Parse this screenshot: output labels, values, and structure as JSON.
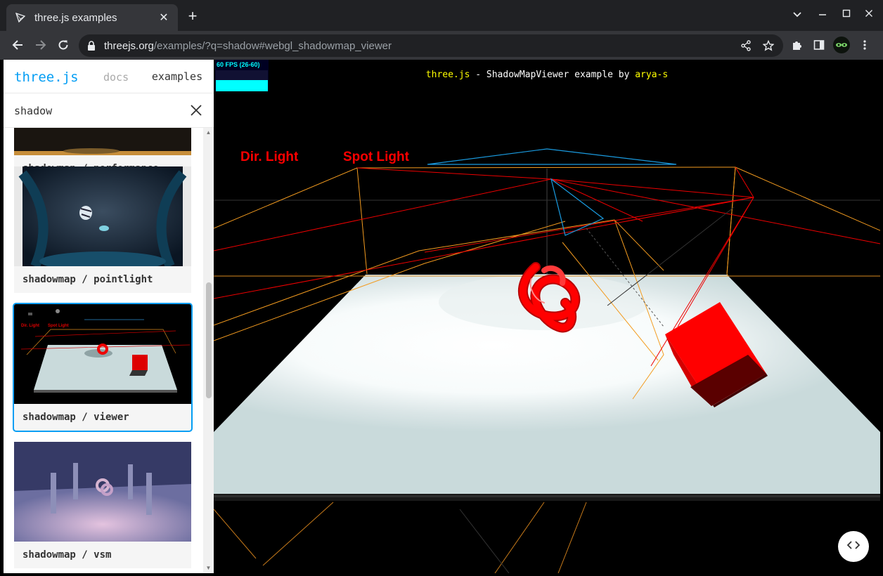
{
  "browser": {
    "tab_title": "three.js examples",
    "url_host": "threejs.org",
    "url_path": "/examples/?q=shadow#webgl_shadowmap_viewer"
  },
  "sidebar": {
    "brand": "three.js",
    "nav_docs": "docs",
    "nav_examples": "examples",
    "search_value": "shadow",
    "examples": [
      {
        "label": "shadowmap / performance"
      },
      {
        "label": "shadowmap / pointlight"
      },
      {
        "label": "shadowmap / viewer",
        "selected": true
      },
      {
        "label": "shadowmap / vsm"
      }
    ]
  },
  "viewer": {
    "fps": "60 FPS (26-60)",
    "info_prefix": "three.js",
    "info_middle": " - ShadowMapViewer example by ",
    "info_author": "arya-s",
    "dir_light_label": "Dir. Light",
    "spot_light_label": "Spot Light"
  },
  "colors": {
    "accent": "#049ef4",
    "torus": "#ff0000",
    "ground": "#c9dadb",
    "spot_helper": "#ff9900",
    "camera_helper": "#1a9be0"
  }
}
